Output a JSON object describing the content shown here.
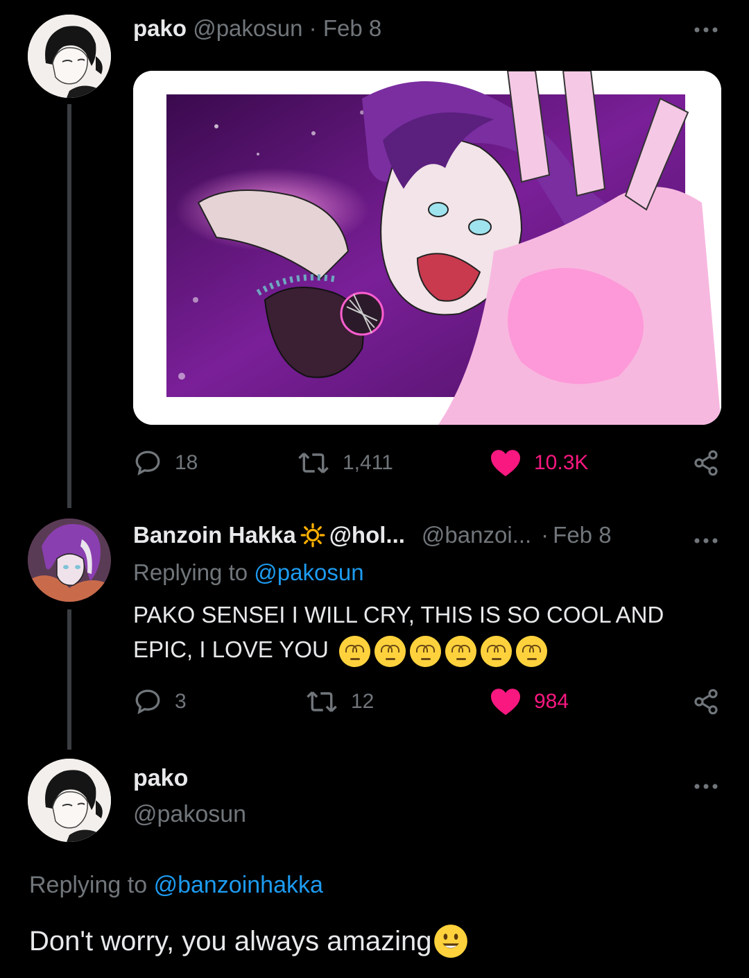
{
  "colors": {
    "background": "#000000",
    "text": "#e7e9ea",
    "muted": "#71767b",
    "link": "#1d9bf0",
    "like": "#f91880",
    "thread_line": "#3a3d41"
  },
  "tweet1": {
    "display_name": "pako",
    "handle": "@pakosun",
    "separator": "·",
    "date": "Feb 8",
    "more_icon": "more-horizontal-icon",
    "image": "anime illustration of purple-haired singer holding a microphone",
    "actions": {
      "reply_icon": "reply-bubble-icon",
      "reply_count": "18",
      "retweet_icon": "retweet-icon",
      "retweet_count": "1,411",
      "like_icon": "heart-filled-icon",
      "like_count": "10.3K",
      "share_icon": "share-icon"
    }
  },
  "tweet2": {
    "display_name": "Banzoin Hakka",
    "badge_icon": "sun-icon",
    "name_suffix": "@hol...",
    "handle": "@banzoi...",
    "separator": "·",
    "date": "Feb 8",
    "replying_prefix": "Replying to",
    "replying_to": "@pakosun",
    "text_line1": "PAKO SENSEI I WILL CRY, THIS IS SO COOL AND",
    "text_line2": "EPIC, I LOVE YOU",
    "emoji_icon": "rolling-eyes-face-icon",
    "actions": {
      "reply_count": "3",
      "retweet_count": "12",
      "like_count": "984"
    }
  },
  "tweet3": {
    "display_name": "pako",
    "handle": "@pakosun",
    "replying_prefix": "Replying to",
    "replying_to": "@banzoinhakka",
    "text": "Don't worry, you always amazing",
    "emoji_icon": "smiling-face-icon"
  }
}
